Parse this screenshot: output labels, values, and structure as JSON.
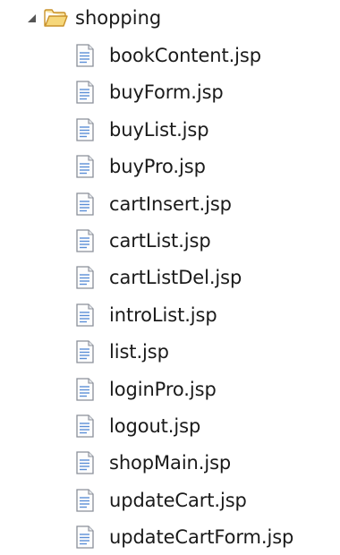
{
  "tree": {
    "folder": {
      "name": "shopping",
      "expanded": true,
      "icon": "open-folder-icon",
      "toggle_icon": "expanded-triangle-icon"
    },
    "files": [
      {
        "name": "bookContent.jsp",
        "icon": "jsp-file-icon"
      },
      {
        "name": "buyForm.jsp",
        "icon": "jsp-file-icon"
      },
      {
        "name": "buyList.jsp",
        "icon": "jsp-file-icon"
      },
      {
        "name": "buyPro.jsp",
        "icon": "jsp-file-icon"
      },
      {
        "name": "cartInsert.jsp",
        "icon": "jsp-file-icon"
      },
      {
        "name": "cartList.jsp",
        "icon": "jsp-file-icon"
      },
      {
        "name": "cartListDel.jsp",
        "icon": "jsp-file-icon"
      },
      {
        "name": "introList.jsp",
        "icon": "jsp-file-icon"
      },
      {
        "name": "list.jsp",
        "icon": "jsp-file-icon"
      },
      {
        "name": "loginPro.jsp",
        "icon": "jsp-file-icon"
      },
      {
        "name": "logout.jsp",
        "icon": "jsp-file-icon"
      },
      {
        "name": "shopMain.jsp",
        "icon": "jsp-file-icon"
      },
      {
        "name": "updateCart.jsp",
        "icon": "jsp-file-icon"
      },
      {
        "name": "updateCartForm.jsp",
        "icon": "jsp-file-icon"
      }
    ]
  },
  "colors": {
    "folder_fill": "#f6d77a",
    "folder_stroke": "#c9922a",
    "file_stroke": "#8a8f99",
    "file_accent": "#5b8fd6",
    "text": "#1a1a1a"
  }
}
